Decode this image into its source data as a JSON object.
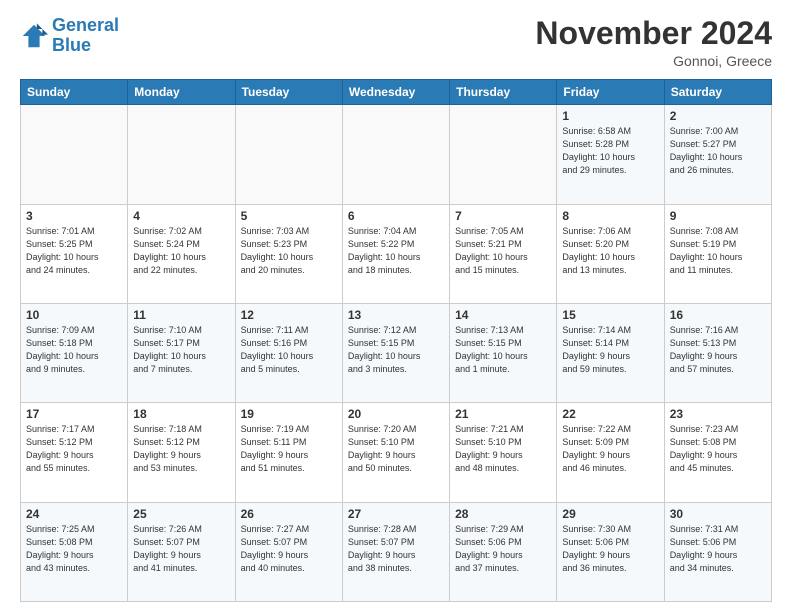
{
  "logo": {
    "line1": "General",
    "line2": "Blue"
  },
  "header": {
    "month": "November 2024",
    "location": "Gonnoi, Greece"
  },
  "weekdays": [
    "Sunday",
    "Monday",
    "Tuesday",
    "Wednesday",
    "Thursday",
    "Friday",
    "Saturday"
  ],
  "weeks": [
    [
      {
        "day": "",
        "info": ""
      },
      {
        "day": "",
        "info": ""
      },
      {
        "day": "",
        "info": ""
      },
      {
        "day": "",
        "info": ""
      },
      {
        "day": "",
        "info": ""
      },
      {
        "day": "1",
        "info": "Sunrise: 6:58 AM\nSunset: 5:28 PM\nDaylight: 10 hours\nand 29 minutes."
      },
      {
        "day": "2",
        "info": "Sunrise: 7:00 AM\nSunset: 5:27 PM\nDaylight: 10 hours\nand 26 minutes."
      }
    ],
    [
      {
        "day": "3",
        "info": "Sunrise: 7:01 AM\nSunset: 5:25 PM\nDaylight: 10 hours\nand 24 minutes."
      },
      {
        "day": "4",
        "info": "Sunrise: 7:02 AM\nSunset: 5:24 PM\nDaylight: 10 hours\nand 22 minutes."
      },
      {
        "day": "5",
        "info": "Sunrise: 7:03 AM\nSunset: 5:23 PM\nDaylight: 10 hours\nand 20 minutes."
      },
      {
        "day": "6",
        "info": "Sunrise: 7:04 AM\nSunset: 5:22 PM\nDaylight: 10 hours\nand 18 minutes."
      },
      {
        "day": "7",
        "info": "Sunrise: 7:05 AM\nSunset: 5:21 PM\nDaylight: 10 hours\nand 15 minutes."
      },
      {
        "day": "8",
        "info": "Sunrise: 7:06 AM\nSunset: 5:20 PM\nDaylight: 10 hours\nand 13 minutes."
      },
      {
        "day": "9",
        "info": "Sunrise: 7:08 AM\nSunset: 5:19 PM\nDaylight: 10 hours\nand 11 minutes."
      }
    ],
    [
      {
        "day": "10",
        "info": "Sunrise: 7:09 AM\nSunset: 5:18 PM\nDaylight: 10 hours\nand 9 minutes."
      },
      {
        "day": "11",
        "info": "Sunrise: 7:10 AM\nSunset: 5:17 PM\nDaylight: 10 hours\nand 7 minutes."
      },
      {
        "day": "12",
        "info": "Sunrise: 7:11 AM\nSunset: 5:16 PM\nDaylight: 10 hours\nand 5 minutes."
      },
      {
        "day": "13",
        "info": "Sunrise: 7:12 AM\nSunset: 5:15 PM\nDaylight: 10 hours\nand 3 minutes."
      },
      {
        "day": "14",
        "info": "Sunrise: 7:13 AM\nSunset: 5:15 PM\nDaylight: 10 hours\nand 1 minute."
      },
      {
        "day": "15",
        "info": "Sunrise: 7:14 AM\nSunset: 5:14 PM\nDaylight: 9 hours\nand 59 minutes."
      },
      {
        "day": "16",
        "info": "Sunrise: 7:16 AM\nSunset: 5:13 PM\nDaylight: 9 hours\nand 57 minutes."
      }
    ],
    [
      {
        "day": "17",
        "info": "Sunrise: 7:17 AM\nSunset: 5:12 PM\nDaylight: 9 hours\nand 55 minutes."
      },
      {
        "day": "18",
        "info": "Sunrise: 7:18 AM\nSunset: 5:12 PM\nDaylight: 9 hours\nand 53 minutes."
      },
      {
        "day": "19",
        "info": "Sunrise: 7:19 AM\nSunset: 5:11 PM\nDaylight: 9 hours\nand 51 minutes."
      },
      {
        "day": "20",
        "info": "Sunrise: 7:20 AM\nSunset: 5:10 PM\nDaylight: 9 hours\nand 50 minutes."
      },
      {
        "day": "21",
        "info": "Sunrise: 7:21 AM\nSunset: 5:10 PM\nDaylight: 9 hours\nand 48 minutes."
      },
      {
        "day": "22",
        "info": "Sunrise: 7:22 AM\nSunset: 5:09 PM\nDaylight: 9 hours\nand 46 minutes."
      },
      {
        "day": "23",
        "info": "Sunrise: 7:23 AM\nSunset: 5:08 PM\nDaylight: 9 hours\nand 45 minutes."
      }
    ],
    [
      {
        "day": "24",
        "info": "Sunrise: 7:25 AM\nSunset: 5:08 PM\nDaylight: 9 hours\nand 43 minutes."
      },
      {
        "day": "25",
        "info": "Sunrise: 7:26 AM\nSunset: 5:07 PM\nDaylight: 9 hours\nand 41 minutes."
      },
      {
        "day": "26",
        "info": "Sunrise: 7:27 AM\nSunset: 5:07 PM\nDaylight: 9 hours\nand 40 minutes."
      },
      {
        "day": "27",
        "info": "Sunrise: 7:28 AM\nSunset: 5:07 PM\nDaylight: 9 hours\nand 38 minutes."
      },
      {
        "day": "28",
        "info": "Sunrise: 7:29 AM\nSunset: 5:06 PM\nDaylight: 9 hours\nand 37 minutes."
      },
      {
        "day": "29",
        "info": "Sunrise: 7:30 AM\nSunset: 5:06 PM\nDaylight: 9 hours\nand 36 minutes."
      },
      {
        "day": "30",
        "info": "Sunrise: 7:31 AM\nSunset: 5:06 PM\nDaylight: 9 hours\nand 34 minutes."
      }
    ]
  ]
}
